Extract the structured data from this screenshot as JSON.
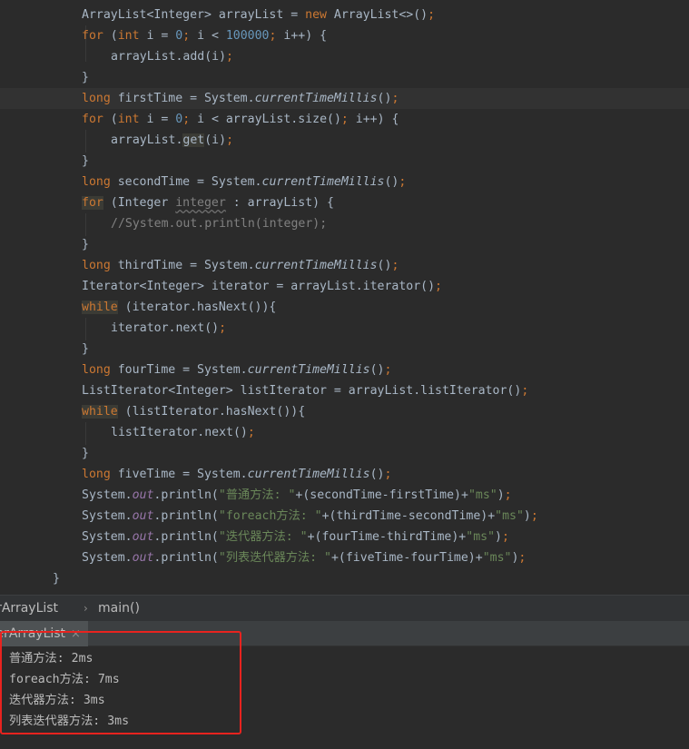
{
  "code": {
    "l1": {
      "a": "ArrayList<Integer> arrayList = ",
      "b": "new",
      "c": " ArrayList<>()",
      "d": ";"
    },
    "l2": {
      "a": "for",
      "b": " (",
      "c": "int",
      "d": " i = ",
      "e": "0",
      "f": "; ",
      "g": "i < ",
      "h": "100000",
      "i": "; ",
      "j": "i++) {"
    },
    "l3": {
      "a": "arrayList.add(i)",
      "b": ";"
    },
    "l4": {
      "a": "}"
    },
    "l5": {
      "a": "long",
      "b": " firstTime = System.",
      "c": "currentTimeMillis",
      "d": "()",
      "e": ";"
    },
    "l6": {
      "a": "for",
      "b": " (",
      "c": "int",
      "d": " i = ",
      "e": "0",
      "f": "; ",
      "g": "i < arrayList.size()",
      "h": "; ",
      "i": "i++) {"
    },
    "l7": {
      "a": "arrayList.",
      "b": "get",
      "c": "(i)",
      "d": ";"
    },
    "l8": {
      "a": "}"
    },
    "l9": {
      "a": "long",
      "b": " secondTime = System.",
      "c": "currentTimeMillis",
      "d": "()",
      "e": ";"
    },
    "l10": {
      "a": "for",
      "b": " (Integer ",
      "c": "integer",
      "d": " : arrayList) {"
    },
    "l11": {
      "a": "//System.out.println(integer);"
    },
    "l12": {
      "a": "}"
    },
    "l13": {
      "a": "long",
      "b": " thirdTime = System.",
      "c": "currentTimeMillis",
      "d": "()",
      "e": ";"
    },
    "l14": {
      "a": "Iterator<Integer> iterator = arrayList.iterator()",
      "b": ";"
    },
    "l15": {
      "a": "while",
      "b": " (iterator.hasNext()){"
    },
    "l16": {
      "a": "iterator.next()",
      "b": ";"
    },
    "l17": {
      "a": "}"
    },
    "l18": {
      "a": "long",
      "b": " fourTime = System.",
      "c": "currentTimeMillis",
      "d": "()",
      "e": ";"
    },
    "l19": {
      "a": "ListIterator<Integer> listIterator = arrayList.listIterator()",
      "b": ";"
    },
    "l20": {
      "a": "while",
      "b": " (listIterator.hasNext()){"
    },
    "l21": {
      "a": "listIterator.next()",
      "b": ";"
    },
    "l22": {
      "a": "}"
    },
    "l23": {
      "a": "long",
      "b": " fiveTime = System.",
      "c": "currentTimeMillis",
      "d": "()",
      "e": ";"
    },
    "l24": {
      "a": "System.",
      "b": "out",
      "c": ".println(",
      "d": "\"普通方法: \"",
      "e": "+(secondTime-firstTime)+",
      "f": "\"ms\"",
      "g": ")",
      "h": ";"
    },
    "l25": {
      "a": "System.",
      "b": "out",
      "c": ".println(",
      "d": "\"foreach方法: \"",
      "e": "+(thirdTime-secondTime)+",
      "f": "\"ms\"",
      "g": ")",
      "h": ";"
    },
    "l26": {
      "a": "System.",
      "b": "out",
      "c": ".println(",
      "d": "\"迭代器方法: \"",
      "e": "+(fourTime-thirdTime)+",
      "f": "\"ms\"",
      "g": ")",
      "h": ";"
    },
    "l27": {
      "a": "System.",
      "b": "out",
      "c": ".println(",
      "d": "\"列表迭代器方法: \"",
      "e": "+(fiveTime-fourTime)+",
      "f": "\"ms\"",
      "g": ")",
      "h": ";"
    },
    "l28": {
      "a": "}"
    }
  },
  "breadcrumb": {
    "class_name": "terArrayList",
    "method": "main()",
    "separator": "›"
  },
  "run_tab": {
    "label": "terArrayList",
    "close_icon": "×"
  },
  "console": {
    "lines": [
      "普通方法: 2ms",
      "foreach方法: 7ms",
      "迭代器方法: 3ms",
      "列表迭代器方法: 3ms"
    ]
  },
  "colors": {
    "highlight_box": "#e8231f",
    "keyword": "#cc7832",
    "string": "#6a8759",
    "number": "#6897bb",
    "field": "#9876aa"
  }
}
